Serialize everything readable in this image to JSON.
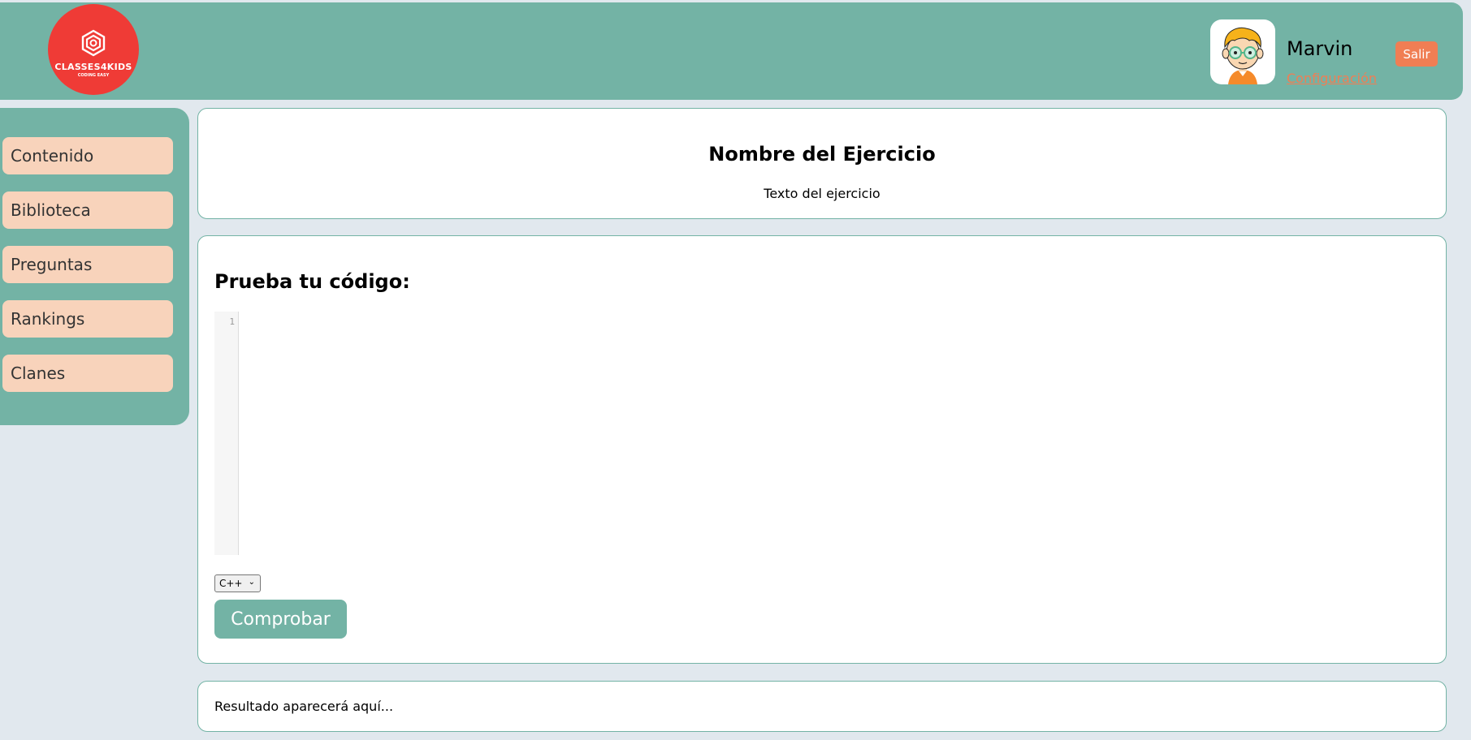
{
  "header": {
    "logo": {
      "wordmark": "CLASSES4KIDS",
      "tagline": "CODING EASY",
      "color": "#ef3b36"
    },
    "user": {
      "name": "Marvin",
      "config_link": "Configuración"
    },
    "logout_label": "Salir",
    "color": "#73b3a5"
  },
  "sidebar": {
    "items": [
      {
        "label": "Contenido"
      },
      {
        "label": "Biblioteca"
      },
      {
        "label": "Preguntas"
      },
      {
        "label": "Rankings"
      },
      {
        "label": "Clanes"
      }
    ],
    "item_color": "#f8d3bb"
  },
  "exercise": {
    "title": "Nombre del Ejercicio",
    "text": "Texto del ejercicio"
  },
  "code": {
    "heading": "Prueba tu código:",
    "editor": {
      "line_numbers": [
        "1"
      ],
      "content": ""
    },
    "language": {
      "selected": "C++"
    },
    "check_label": "Comprobar"
  },
  "result": {
    "text": "Resultado aparecerá aquí..."
  },
  "colors": {
    "accent": "#73b3a5",
    "orange": "#f07e54",
    "background": "#e1e8ee"
  }
}
